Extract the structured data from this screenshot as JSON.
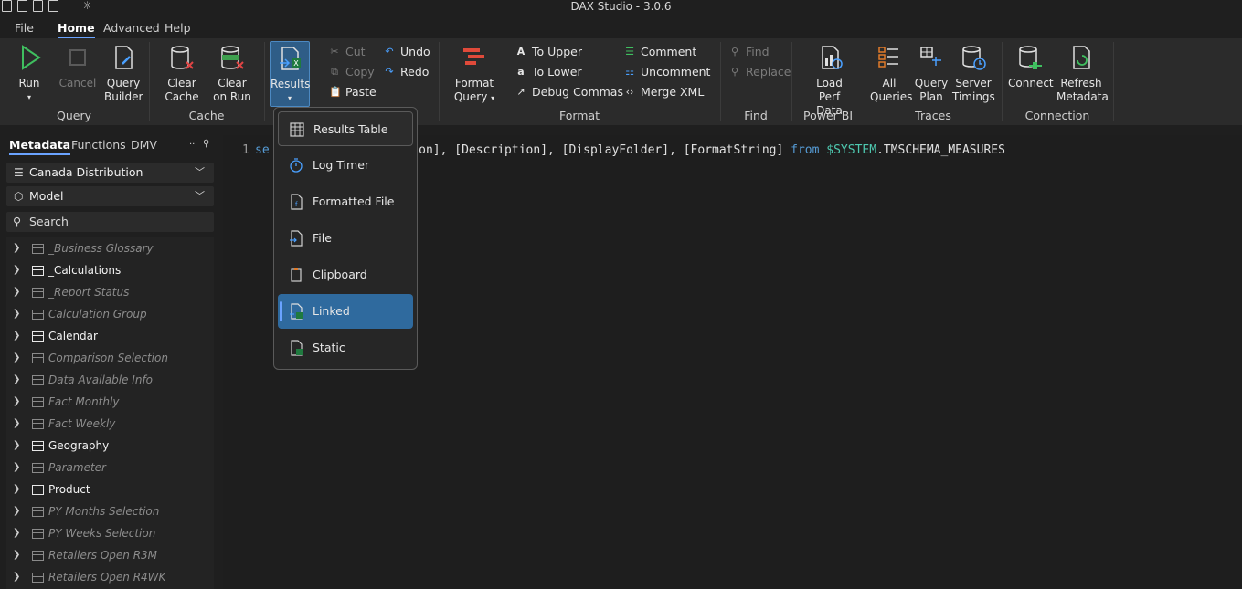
{
  "window": {
    "title": "DAX Studio - 3.0.6"
  },
  "menu": {
    "file": "File",
    "home": "Home",
    "advanced": "Advanced",
    "help": "Help"
  },
  "ribbon": {
    "run": "Run",
    "cancel": "Cancel",
    "query_builder": [
      "Query",
      "Builder"
    ],
    "clear_cache": [
      "Clear",
      "Cache"
    ],
    "clear_on_run": [
      "Clear",
      "on Run"
    ],
    "results": "Results",
    "cut": "Cut",
    "copy": "Copy",
    "paste": "Paste",
    "undo": "Undo",
    "redo": "Redo",
    "format_query": [
      "Format",
      "Query"
    ],
    "to_upper": "To Upper",
    "to_lower": "To Lower",
    "debug_commas": "Debug Commas",
    "comment": "Comment",
    "uncomment": "Uncomment",
    "merge_xml": "Merge XML",
    "find": "Find",
    "replace": "Replace",
    "load_perf": [
      "Load Perf",
      "Data"
    ],
    "all_queries": [
      "All",
      "Queries"
    ],
    "query_plan": [
      "Query",
      "Plan"
    ],
    "server_timings": [
      "Server",
      "Timings"
    ],
    "connect": "Connect",
    "refresh_metadata": [
      "Refresh",
      "Metadata"
    ],
    "groups": {
      "query": "Query",
      "cache": "Cache",
      "format": "Format",
      "find": "Find",
      "power_bi": "Power BI",
      "traces": "Traces",
      "connection": "Connection"
    }
  },
  "panel": {
    "tabs": {
      "metadata": "Metadata",
      "functions": "Functions",
      "dmv": "DMV"
    },
    "database": "Canada Distribution",
    "model": "Model",
    "search_placeholder": "Search",
    "tables": [
      {
        "name": "_Business Glossary",
        "hidden": true
      },
      {
        "name": "_Calculations",
        "hidden": false
      },
      {
        "name": "_Report Status",
        "hidden": true
      },
      {
        "name": "Calculation Group",
        "hidden": true
      },
      {
        "name": "Calendar",
        "hidden": false
      },
      {
        "name": "Comparison Selection",
        "hidden": true
      },
      {
        "name": "Data Available Info",
        "hidden": true
      },
      {
        "name": "Fact Monthly",
        "hidden": true
      },
      {
        "name": "Fact Weekly",
        "hidden": true
      },
      {
        "name": "Geography",
        "hidden": false
      },
      {
        "name": "Parameter",
        "hidden": true
      },
      {
        "name": "Product",
        "hidden": false
      },
      {
        "name": "PY Months Selection",
        "hidden": true
      },
      {
        "name": "PY Weeks Selection",
        "hidden": true
      },
      {
        "name": "Retailers Open R3M",
        "hidden": true
      },
      {
        "name": "Retailers Open R4WK",
        "hidden": true
      }
    ]
  },
  "editor": {
    "line_number": "1",
    "code_start": "se",
    "code_middle": "ssion], [Description], [DisplayFolder], [FormatString] ",
    "code_from": "from",
    "code_system": "$SYSTEM",
    "code_end": ".TMSCHEMA_MEASURES"
  },
  "results_menu": {
    "items": [
      "Results Table",
      "Log Timer",
      "Formatted File",
      "File",
      "Clipboard",
      "Linked",
      "Static"
    ],
    "active_index": 5
  }
}
